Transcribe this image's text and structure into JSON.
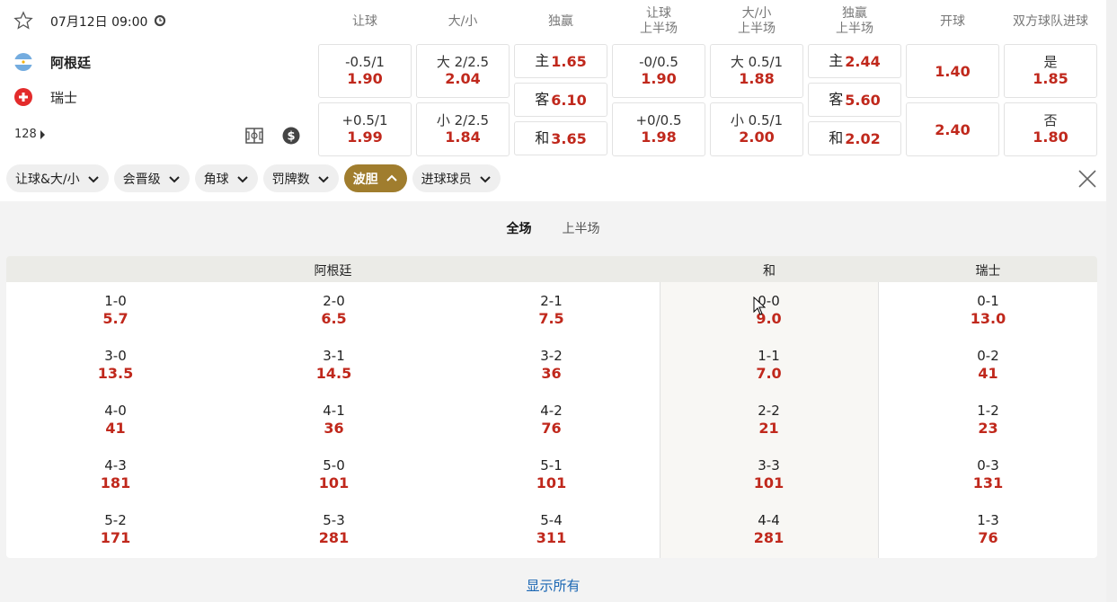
{
  "match": {
    "date": "07月12日 09:00",
    "home": "阿根廷",
    "away": "瑞士",
    "markets_count": "128"
  },
  "colors": {
    "accent": "#a07d2e",
    "odds": "#c0281c",
    "link": "#1a66b3"
  },
  "columns": [
    {
      "line1": "让球",
      "line2": ""
    },
    {
      "line1": "大/小",
      "line2": ""
    },
    {
      "line1": "独赢",
      "line2": ""
    },
    {
      "line1": "让球",
      "line2": "上半场"
    },
    {
      "line1": "大/小",
      "line2": "上半场"
    },
    {
      "line1": "独赢",
      "line2": "上半场"
    },
    {
      "line1": "开球",
      "line2": ""
    },
    {
      "line1": "双方球队进球",
      "line2": ""
    }
  ],
  "odds": {
    "hdp_home": {
      "line": "-0.5/1",
      "price": "1.90"
    },
    "hdp_away": {
      "line": "+0.5/1",
      "price": "1.99"
    },
    "ou_over": {
      "line": "大 2/2.5",
      "price": "2.04"
    },
    "ou_under": {
      "line": "小 2/2.5",
      "price": "1.84"
    },
    "ml_home": {
      "line": "主",
      "price": "1.65"
    },
    "ml_away": {
      "line": "客",
      "price": "6.10"
    },
    "ml_draw": {
      "line": "和",
      "price": "3.65"
    },
    "hdp1h_home": {
      "line": "-0/0.5",
      "price": "1.90"
    },
    "hdp1h_away": {
      "line": "+0/0.5",
      "price": "1.98"
    },
    "ou1h_over": {
      "line": "大 0.5/1",
      "price": "1.88"
    },
    "ou1h_under": {
      "line": "小 0.5/1",
      "price": "2.00"
    },
    "ml1h_home": {
      "line": "主",
      "price": "2.44"
    },
    "ml1h_away": {
      "line": "客",
      "price": "5.60"
    },
    "ml1h_draw": {
      "line": "和",
      "price": "2.02"
    },
    "kickoff_home": {
      "price": "1.40"
    },
    "kickoff_away": {
      "price": "2.40"
    },
    "btts_yes": {
      "line": "是",
      "price": "1.85"
    },
    "btts_no": {
      "line": "否",
      "price": "1.80"
    }
  },
  "filters": [
    "让球&大/小",
    "会晋级",
    "角球",
    "罚牌数",
    "波胆",
    "进球球员"
  ],
  "period_tabs": [
    "全场",
    "上半场"
  ],
  "cs_headers": {
    "home": "阿根廷",
    "draw": "和",
    "away": "瑞士"
  },
  "correct_score": [
    [
      {
        "s": "1-0",
        "v": "5.7"
      },
      {
        "s": "2-0",
        "v": "6.5"
      },
      {
        "s": "2-1",
        "v": "7.5"
      },
      {
        "s": "0-0",
        "v": "9.0"
      },
      {
        "s": "0-1",
        "v": "13.0"
      }
    ],
    [
      {
        "s": "3-0",
        "v": "13.5"
      },
      {
        "s": "3-1",
        "v": "14.5"
      },
      {
        "s": "3-2",
        "v": "36"
      },
      {
        "s": "1-1",
        "v": "7.0"
      },
      {
        "s": "0-2",
        "v": "41"
      }
    ],
    [
      {
        "s": "4-0",
        "v": "41"
      },
      {
        "s": "4-1",
        "v": "36"
      },
      {
        "s": "4-2",
        "v": "76"
      },
      {
        "s": "2-2",
        "v": "21"
      },
      {
        "s": "1-2",
        "v": "23"
      }
    ],
    [
      {
        "s": "4-3",
        "v": "181"
      },
      {
        "s": "5-0",
        "v": "101"
      },
      {
        "s": "5-1",
        "v": "101"
      },
      {
        "s": "3-3",
        "v": "101"
      },
      {
        "s": "0-3",
        "v": "131"
      }
    ],
    [
      {
        "s": "5-2",
        "v": "171"
      },
      {
        "s": "5-3",
        "v": "281"
      },
      {
        "s": "5-4",
        "v": "311"
      },
      {
        "s": "4-4",
        "v": "281"
      },
      {
        "s": "1-3",
        "v": "76"
      }
    ]
  ],
  "show_all": "显示所有"
}
